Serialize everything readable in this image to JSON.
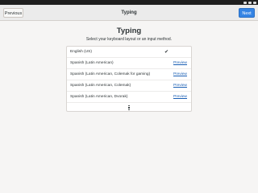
{
  "header": {
    "previous_label": "Previous",
    "title": "Typing",
    "next_label": "Next"
  },
  "main": {
    "title": "Typing",
    "subtitle": "Select your keyboard layout or an input method."
  },
  "layouts": [
    {
      "label": "English (US)",
      "selected": true,
      "link": ""
    },
    {
      "label": "Spanish (Latin American)",
      "selected": false,
      "link": "Preview"
    },
    {
      "label": "Spanish (Latin American, Colemak for gaming)",
      "selected": false,
      "link": "Preview"
    },
    {
      "label": "Spanish (Latin American, Colemak)",
      "selected": false,
      "link": "Preview"
    },
    {
      "label": "Spanish (Latin American, Dvorak)",
      "selected": false,
      "link": "Preview"
    }
  ],
  "colors": {
    "accent": "#3584e4",
    "link": "#1a5fb4",
    "background": "#f6f5f4"
  },
  "icons": {
    "selected": "checkmark-icon",
    "more": "view-more-icon"
  }
}
